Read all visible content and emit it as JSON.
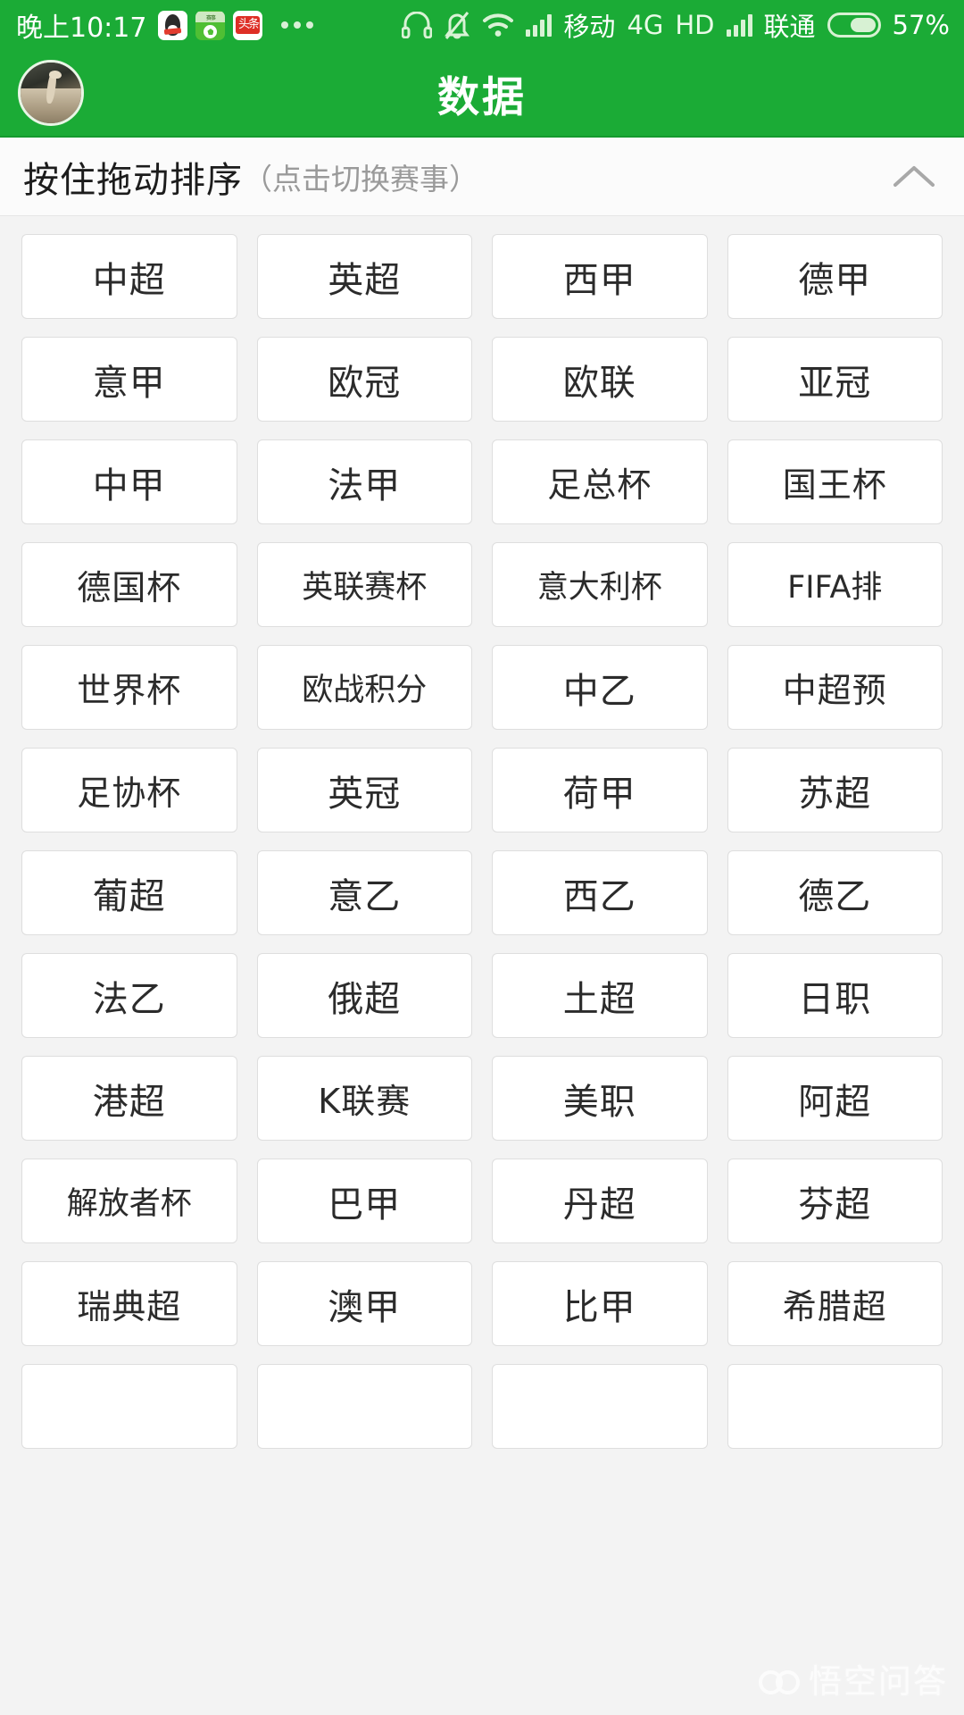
{
  "status_bar": {
    "time": "晚上10:17",
    "app_icons": [
      "qq-icon",
      "soccer-app-icon",
      "toutiao-icon",
      "more-dots-icon"
    ],
    "headset_icon": "headset-icon",
    "mute_icon": "bell-muted-icon",
    "wifi_icon": "wifi-icon",
    "signal_icon_1": "signal-bars-icon",
    "carrier_1": "移动",
    "network_type": "4G",
    "hd_label": "HD",
    "signal_icon_2": "signal-bars-icon",
    "carrier_2": "联通",
    "battery_icon": "battery-icon",
    "battery_percent": "57%",
    "battery_level": 57
  },
  "header": {
    "avatar": "user-avatar",
    "title": "数据"
  },
  "sort_bar": {
    "title": "按住拖动排序",
    "hint": "（点击切换赛事）",
    "collapse_icon": "chevron-up-icon"
  },
  "leagues": [
    "中超",
    "英超",
    "西甲",
    "德甲",
    "意甲",
    "欧冠",
    "欧联",
    "亚冠",
    "中甲",
    "法甲",
    "足总杯",
    "国王杯",
    "德国杯",
    "英联赛杯",
    "意大利杯",
    "FIFA排",
    "世界杯",
    "欧战积分",
    "中乙",
    "中超预",
    "足协杯",
    "英冠",
    "荷甲",
    "苏超",
    "葡超",
    "意乙",
    "西乙",
    "德乙",
    "法乙",
    "俄超",
    "土超",
    "日职",
    "港超",
    "K联赛",
    "美职",
    "阿超",
    "解放者杯",
    "巴甲",
    "丹超",
    "芬超",
    "瑞典超",
    "澳甲",
    "比甲",
    "希腊超",
    "",
    "",
    "",
    ""
  ],
  "watermark": {
    "logo": "wukong-logo-icon",
    "text": "悟空问答"
  },
  "colors": {
    "brand_green": "#1bab36",
    "page_background": "#f3f3f3",
    "cell_background": "#ffffff",
    "cell_border": "#dedede",
    "text_primary": "#2b2b2b",
    "text_muted": "#9a9a9a"
  }
}
